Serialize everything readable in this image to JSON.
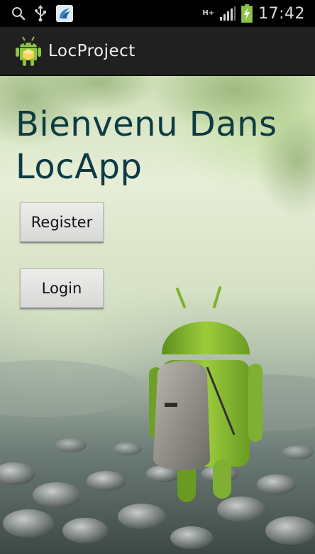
{
  "status_bar": {
    "network_type": "H+",
    "time": "17:42",
    "icons": [
      "search-icon",
      "usb-icon",
      "app-notification-icon",
      "network-arrows-icon",
      "signal-icon",
      "battery-charging-icon"
    ]
  },
  "action_bar": {
    "app_icon": "android-app-icon",
    "title": "LocProject"
  },
  "main": {
    "welcome_text": "Bienvenu Dans LocApp",
    "register_label": "Register",
    "login_label": "Login",
    "background": "android-backpack-photo"
  },
  "colors": {
    "action_bar": "#202020",
    "status_bar": "#000000",
    "welcome_text": "#0d3a43",
    "android_green": "#8cc63f",
    "button": "#e2e2e0"
  }
}
